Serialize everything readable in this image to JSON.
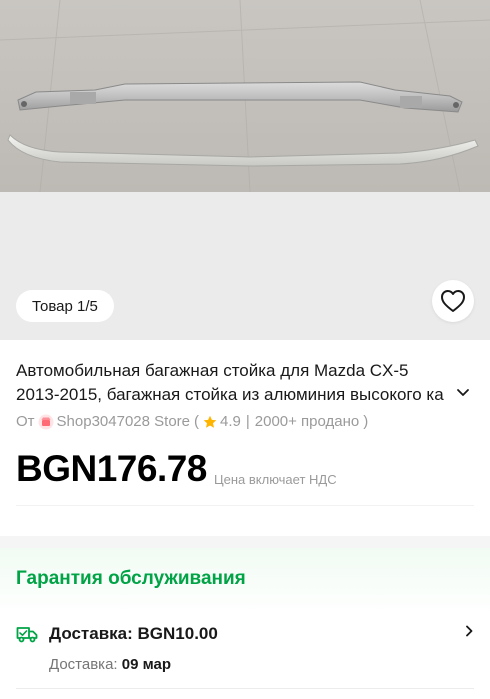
{
  "gallery": {
    "counter": "Товар 1/5",
    "image_icon": "product-photo-roof-rails",
    "favorite_icon": "heart-outline-icon"
  },
  "product": {
    "title": "Автомобильная багажная стойка для Mazda CX-5 2013-2015, багажная стойка из алюминия высокого ка",
    "store_prefix": "От",
    "store_name": "Shop3047028 Store",
    "rating_open": "(",
    "rating": "4.9",
    "separator": "|",
    "sold": "2000+ продано",
    "rating_close": ")",
    "price": "BGN176.78",
    "tax_note": "Цена включает НДС"
  },
  "service": {
    "title": "Гарантия обслуживания",
    "delivery_label": "Доставка: BGN10.00",
    "delivery_date_label": "Доставка:",
    "delivery_date_value": "09 мар"
  },
  "colors": {
    "accent_green": "#00a346",
    "star": "#ffb400",
    "store_badge": "#ff6a74"
  }
}
